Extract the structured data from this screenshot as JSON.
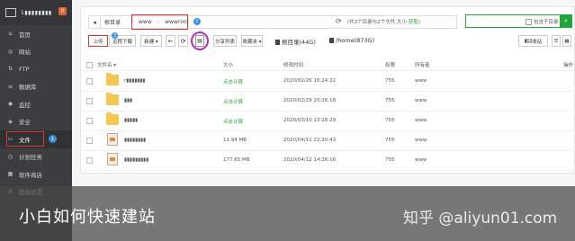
{
  "sidebar": {
    "host": "1▮▮▮▮▮▮▮▮",
    "badge": "0",
    "items": [
      {
        "label": "首页",
        "icon": "home-icon",
        "glyph": "⌂"
      },
      {
        "label": "网站",
        "icon": "globe-icon",
        "glyph": "◎"
      },
      {
        "label": "FTP",
        "icon": "ftp-icon",
        "glyph": "⇅"
      },
      {
        "label": "数据库",
        "icon": "database-icon",
        "glyph": "≡"
      },
      {
        "label": "监控",
        "icon": "monitor-icon",
        "glyph": "◉"
      },
      {
        "label": "安全",
        "icon": "shield-icon",
        "glyph": "◈"
      },
      {
        "label": "文件",
        "icon": "folder-icon",
        "glyph": "▭",
        "active": true,
        "badge": "1"
      },
      {
        "label": "计划任务",
        "icon": "clock-icon",
        "glyph": "◷"
      },
      {
        "label": "软件商店",
        "icon": "store-icon",
        "glyph": "▦"
      },
      {
        "label": "面板设置",
        "icon": "gear-icon",
        "glyph": "⚙"
      }
    ]
  },
  "pathbar": {
    "root": "根目录",
    "crumbs": [
      "www",
      "wwwroot"
    ],
    "info_badge": "2"
  },
  "stats": {
    "prefix": "共3个目录与2个文件,大小:",
    "size_link": "获取"
  },
  "search": {
    "placeholder": "",
    "checkbox_label": "包含子目录"
  },
  "toolbar": {
    "upload": "上传",
    "upload_badge": "3",
    "remote_download": "远程下载",
    "new": "新建 ▾",
    "share_list": "分享列表",
    "favorites": "收藏夹 ▾",
    "disk_root": "根目录(44G)",
    "disk_home": "/home(873G)",
    "trash": "回收站"
  },
  "table": {
    "headers": [
      "文件名 ▾",
      "大小",
      "修改时间",
      "权限",
      "所有者",
      "操作"
    ],
    "rows": [
      {
        "type": "folder",
        "name": "r▮▮▮▮▮▮▮",
        "size": "点击计算",
        "mtime": "2020/02/26 16:24:22",
        "perm": "755",
        "owner": "www"
      },
      {
        "type": "folder",
        "name": "▮▮▮",
        "size": "点击计算",
        "mtime": "2020/02/29 20:26:18",
        "perm": "755",
        "owner": "www"
      },
      {
        "type": "folder",
        "name": "▮▮▮▮▮",
        "size": "点击计算",
        "mtime": "2020/03/10 13:28:29",
        "perm": "755",
        "owner": "www"
      },
      {
        "type": "file",
        "name": "▮▮▮▮▮▮▮▮",
        "size": "11.94 MB",
        "mtime": "2020/04/11 22:20:43",
        "perm": "755",
        "owner": "www"
      },
      {
        "type": "file",
        "name": "▮▮▮▮▮▮▮▮▮",
        "size": "177.65 MB",
        "mtime": "2020/04/12 14:36:16",
        "perm": "755",
        "owner": "www"
      }
    ]
  },
  "caption": "小白如何快速建站",
  "watermark": "知乎 @aliyun01.com"
}
